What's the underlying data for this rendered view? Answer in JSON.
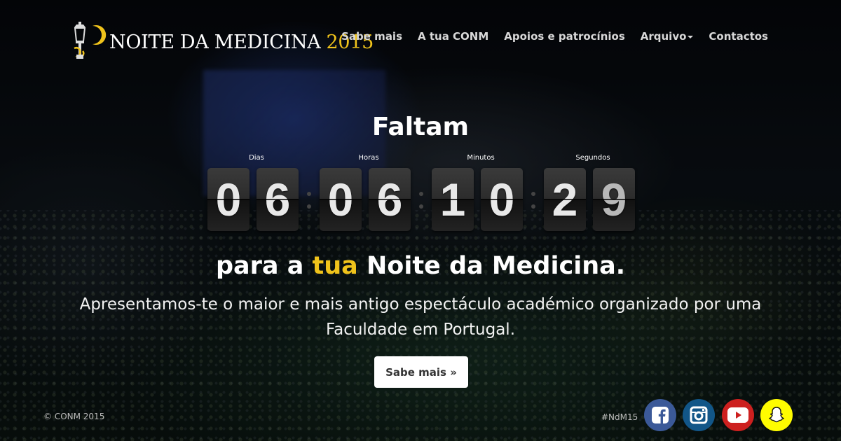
{
  "brand": {
    "name": "NOITE DA MEDICINA",
    "year": "2015",
    "accent_color": "#f0c31b"
  },
  "nav": {
    "items": [
      {
        "label": "Sabe mais"
      },
      {
        "label": "A tua CONM"
      },
      {
        "label": "Apoios e patrocínios"
      },
      {
        "label": "Arquivo",
        "has_dropdown": true
      }
    ],
    "contact_label": "Contactos"
  },
  "hero": {
    "title": "Faltam",
    "tagline_before": "para a ",
    "tagline_highlight": "tua",
    "tagline_after": " Noite da Medicina.",
    "description": "Apresentamos-te o maior e mais antigo espectáculo académico organizado por uma Faculdade em Portugal.",
    "cta_label": "Sabe mais »"
  },
  "countdown": {
    "labels": {
      "days": "Dias",
      "hours": "Horas",
      "minutes": "Minutos",
      "seconds": "Segundos"
    },
    "days": [
      "0",
      "6"
    ],
    "hours": [
      "0",
      "6"
    ],
    "minutes": [
      "1",
      "0"
    ],
    "seconds": [
      "2",
      "9"
    ]
  },
  "footer": {
    "copyright": "© CONM 2015",
    "hashtag": "#NdM15",
    "social": [
      {
        "icon": "facebook-icon",
        "color": "#3b5998"
      },
      {
        "icon": "instagram-icon",
        "color": "#125688"
      },
      {
        "icon": "youtube-icon",
        "color": "#cd201f"
      },
      {
        "icon": "snapchat-icon",
        "color": "#fffc00"
      }
    ]
  }
}
